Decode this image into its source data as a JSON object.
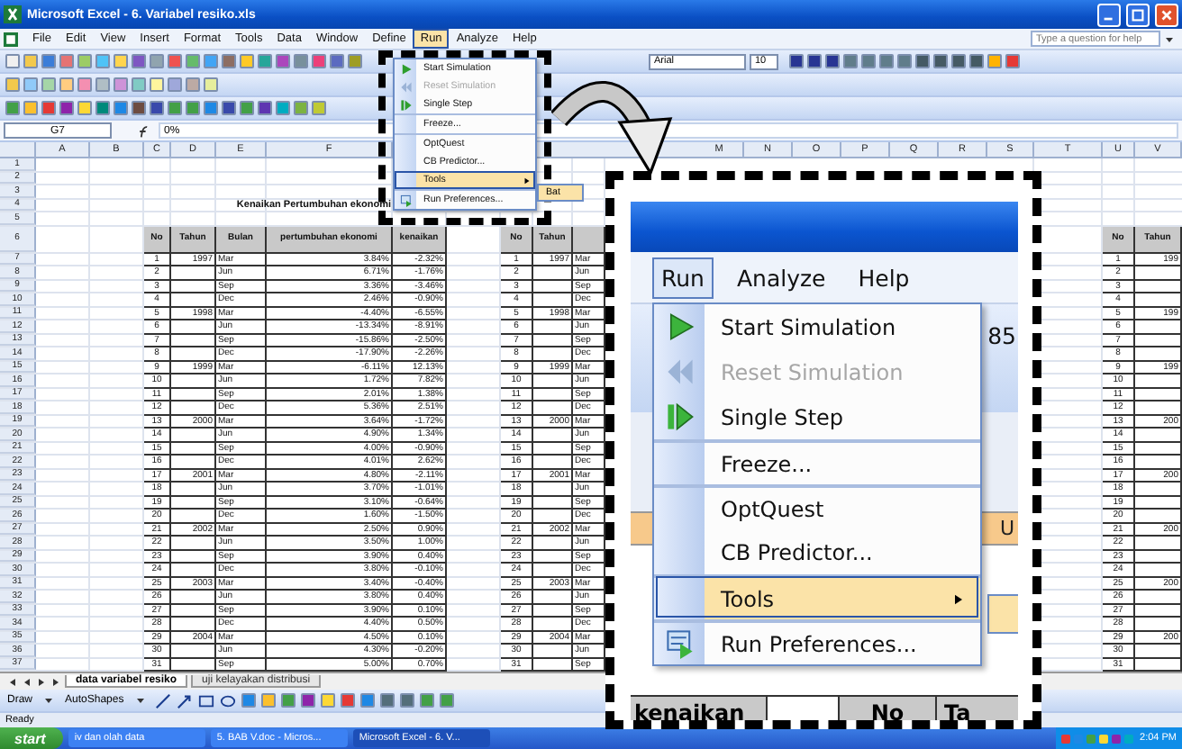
{
  "window": {
    "title": "Microsoft Excel - 6. Variabel resiko.xls"
  },
  "menu_bar": [
    {
      "label": "File",
      "selected": false
    },
    {
      "label": "Edit",
      "selected": false
    },
    {
      "label": "View",
      "selected": false
    },
    {
      "label": "Insert",
      "selected": false
    },
    {
      "label": "Format",
      "selected": false
    },
    {
      "label": "Tools",
      "selected": false
    },
    {
      "label": "Data",
      "selected": false
    },
    {
      "label": "Window",
      "selected": false
    },
    {
      "label": "Define",
      "selected": false
    },
    {
      "label": "Run",
      "selected": true
    },
    {
      "label": "Analyze",
      "selected": false
    },
    {
      "label": "Help",
      "selected": false
    }
  ],
  "help_box": {
    "placeholder": "Type a question for help"
  },
  "font_box": {
    "value": "Arial"
  },
  "size_box": {
    "value": "10"
  },
  "formula_bar": {
    "name_box": "G7",
    "value": "0%"
  },
  "column_headers": [
    "A",
    "B",
    "C",
    "D",
    "E",
    "F",
    "M",
    "N",
    "O",
    "P",
    "Q",
    "R",
    "S",
    "T",
    "U",
    "V"
  ],
  "sheet": {
    "row_numbers": [
      "1",
      "2",
      "3",
      "4",
      "5",
      "6",
      "7",
      "8",
      "9",
      "10",
      "11",
      "12",
      "13",
      "14",
      "15",
      "16",
      "17",
      "18",
      "19",
      "20",
      "21",
      "22",
      "23",
      "24",
      "25",
      "26",
      "27",
      "28",
      "29",
      "30",
      "31",
      "32",
      "33",
      "34",
      "35",
      "36",
      "37"
    ],
    "title": "Kenaikan Pertumbuhan ekonomi",
    "table": {
      "columns": [
        "No",
        "Tahun",
        "Bulan",
        "pertumbuhan ekonomi",
        "kenaikan"
      ],
      "rows": [
        {
          "no": "1",
          "tahun": "1997",
          "bulan": "Mar",
          "growth": "3.84%",
          "kenaikan": "-2.32%"
        },
        {
          "no": "2",
          "bulan": "Jun",
          "growth": "6.71%",
          "kenaikan": "-1.76%"
        },
        {
          "no": "3",
          "bulan": "Sep",
          "growth": "3.36%",
          "kenaikan": "-3.46%"
        },
        {
          "no": "4",
          "bulan": "Dec",
          "growth": "2.46%",
          "kenaikan": "-0.90%"
        },
        {
          "no": "5",
          "tahun": "1998",
          "bulan": "Mar",
          "growth": "-4.40%",
          "kenaikan": "-6.55%"
        },
        {
          "no": "6",
          "bulan": "Jun",
          "growth": "-13.34%",
          "kenaikan": "-8.91%"
        },
        {
          "no": "7",
          "bulan": "Sep",
          "growth": "-15.86%",
          "kenaikan": "-2.50%"
        },
        {
          "no": "8",
          "bulan": "Dec",
          "growth": "-17.90%",
          "kenaikan": "-2.26%"
        },
        {
          "no": "9",
          "tahun": "1999",
          "bulan": "Mar",
          "growth": "-6.11%",
          "kenaikan": "12.13%"
        },
        {
          "no": "10",
          "bulan": "Jun",
          "growth": "1.72%",
          "kenaikan": "7.82%"
        },
        {
          "no": "11",
          "bulan": "Sep",
          "growth": "2.01%",
          "kenaikan": "1.38%"
        },
        {
          "no": "12",
          "bulan": "Dec",
          "growth": "5.36%",
          "kenaikan": "2.51%"
        },
        {
          "no": "13",
          "tahun": "2000",
          "bulan": "Mar",
          "growth": "3.64%",
          "kenaikan": "-1.72%"
        },
        {
          "no": "14",
          "bulan": "Jun",
          "growth": "4.90%",
          "kenaikan": "1.34%"
        },
        {
          "no": "15",
          "bulan": "Sep",
          "growth": "4.00%",
          "kenaikan": "-0.90%"
        },
        {
          "no": "16",
          "bulan": "Dec",
          "growth": "4.01%",
          "kenaikan": "2.62%"
        },
        {
          "no": "17",
          "tahun": "2001",
          "bulan": "Mar",
          "growth": "4.80%",
          "kenaikan": "-2.11%"
        },
        {
          "no": "18",
          "bulan": "Jun",
          "growth": "3.70%",
          "kenaikan": "-1.01%"
        },
        {
          "no": "19",
          "bulan": "Sep",
          "growth": "3.10%",
          "kenaikan": "-0.64%"
        },
        {
          "no": "20",
          "bulan": "Dec",
          "growth": "1.60%",
          "kenaikan": "-1.50%"
        },
        {
          "no": "21",
          "tahun": "2002",
          "bulan": "Mar",
          "growth": "2.50%",
          "kenaikan": "0.90%"
        },
        {
          "no": "22",
          "bulan": "Jun",
          "growth": "3.50%",
          "kenaikan": "1.00%"
        },
        {
          "no": "23",
          "bulan": "Sep",
          "growth": "3.90%",
          "kenaikan": "0.40%"
        },
        {
          "no": "24",
          "bulan": "Dec",
          "growth": "3.80%",
          "kenaikan": "-0.10%"
        },
        {
          "no": "25",
          "tahun": "2003",
          "bulan": "Mar",
          "growth": "3.40%",
          "kenaikan": "-0.40%"
        },
        {
          "no": "26",
          "bulan": "Jun",
          "growth": "3.80%",
          "kenaikan": "0.40%"
        },
        {
          "no": "27",
          "bulan": "Sep",
          "growth": "3.90%",
          "kenaikan": "0.10%"
        },
        {
          "no": "28",
          "bulan": "Dec",
          "growth": "4.40%",
          "kenaikan": "0.50%"
        },
        {
          "no": "29",
          "tahun": "2004",
          "bulan": "Mar",
          "growth": "4.50%",
          "kenaikan": "0.10%"
        },
        {
          "no": "30",
          "bulan": "Jun",
          "growth": "4.30%",
          "kenaikan": "-0.20%"
        },
        {
          "no": "31",
          "bulan": "Sep",
          "growth": "5.00%",
          "kenaikan": "0.70%"
        }
      ]
    },
    "table_2": {
      "columns": [
        "No",
        "Tahun"
      ],
      "rows": [
        {
          "no": "1",
          "tahun": "1997",
          "bulan": "Mar"
        },
        {
          "no": "2",
          "bulan": "Jun"
        },
        {
          "no": "3",
          "bulan": "Sep"
        },
        {
          "no": "4",
          "bulan": "Dec"
        },
        {
          "no": "5",
          "tahun": "1998",
          "bulan": "Mar"
        },
        {
          "no": "6",
          "bulan": "Jun"
        },
        {
          "no": "7",
          "bulan": "Sep"
        },
        {
          "no": "8",
          "bulan": "Dec"
        },
        {
          "no": "9",
          "tahun": "1999",
          "bulan": "Mar"
        },
        {
          "no": "10",
          "bulan": "Jun"
        },
        {
          "no": "11",
          "bulan": "Sep"
        },
        {
          "no": "12",
          "bulan": "Dec"
        },
        {
          "no": "13",
          "tahun": "2000",
          "bulan": "Mar"
        },
        {
          "no": "14",
          "bulan": "Jun"
        },
        {
          "no": "15",
          "bulan": "Sep"
        },
        {
          "no": "16",
          "bulan": "Dec"
        },
        {
          "no": "17",
          "tahun": "2001",
          "bulan": "Mar"
        },
        {
          "no": "18",
          "bulan": "Jun"
        },
        {
          "no": "19",
          "bulan": "Sep"
        },
        {
          "no": "20",
          "bulan": "Dec"
        },
        {
          "no": "21",
          "tahun": "2002",
          "bulan": "Mar"
        },
        {
          "no": "22",
          "bulan": "Jun"
        },
        {
          "no": "23",
          "bulan": "Sep"
        },
        {
          "no": "24",
          "bulan": "Dec"
        },
        {
          "no": "25",
          "tahun": "2003",
          "bulan": "Mar"
        },
        {
          "no": "26",
          "bulan": "Jun"
        },
        {
          "no": "27",
          "bulan": "Sep"
        },
        {
          "no": "28",
          "bulan": "Dec"
        },
        {
          "no": "29",
          "tahun": "2004",
          "bulan": "Mar"
        },
        {
          "no": "30",
          "bulan": "Jun"
        },
        {
          "no": "31",
          "bulan": "Sep"
        }
      ]
    },
    "table_3": {
      "columns": [
        "No",
        "Tahun"
      ],
      "rows": [
        {
          "no": "1",
          "tahun": "199"
        },
        {
          "no": "2"
        },
        {
          "no": "3"
        },
        {
          "no": "4"
        },
        {
          "no": "5",
          "tahun": "199"
        },
        {
          "no": "6"
        },
        {
          "no": "7"
        },
        {
          "no": "8"
        },
        {
          "no": "9",
          "tahun": "199"
        },
        {
          "no": "10"
        },
        {
          "no": "11"
        },
        {
          "no": "12"
        },
        {
          "no": "13",
          "tahun": "200"
        },
        {
          "no": "14"
        },
        {
          "no": "15"
        },
        {
          "no": "16"
        },
        {
          "no": "17",
          "tahun": "200"
        },
        {
          "no": "18"
        },
        {
          "no": "19"
        },
        {
          "no": "20"
        },
        {
          "no": "21",
          "tahun": "200"
        },
        {
          "no": "22"
        },
        {
          "no": "23"
        },
        {
          "no": "24"
        },
        {
          "no": "25",
          "tahun": "200"
        },
        {
          "no": "26"
        },
        {
          "no": "27"
        },
        {
          "no": "28"
        },
        {
          "no": "29",
          "tahun": "200"
        },
        {
          "no": "30"
        },
        {
          "no": "31"
        }
      ]
    }
  },
  "run_menu": {
    "items": [
      {
        "label": "Start Simulation",
        "disabled": false,
        "selected": false,
        "separated": false,
        "submenu": false
      },
      {
        "label": "Reset Simulation",
        "disabled": true,
        "selected": false,
        "separated": false,
        "submenu": false
      },
      {
        "label": "Single Step",
        "disabled": false,
        "selected": false,
        "separated": false,
        "submenu": false
      },
      {
        "label": "Freeze...",
        "disabled": false,
        "selected": false,
        "separated": true,
        "submenu": false
      },
      {
        "label": "OptQuest",
        "disabled": false,
        "selected": false,
        "separated": true,
        "submenu": false
      },
      {
        "label": "CB Predictor...",
        "disabled": false,
        "selected": false,
        "separated": false,
        "submenu": false
      },
      {
        "label": "Tools",
        "disabled": false,
        "selected": true,
        "separated": false,
        "submenu": true
      },
      {
        "label": "Run Preferences...",
        "disabled": false,
        "selected": false,
        "separated": true,
        "submenu": false
      }
    ],
    "submenu_item": "Bat"
  },
  "callout": {
    "menu_bar": [
      {
        "label": "Run",
        "selected": true
      },
      {
        "label": "Analyze",
        "selected": false
      },
      {
        "label": "Help",
        "selected": false
      }
    ],
    "zoom_value": "85",
    "column_letter": "U",
    "headers": [
      "kenaikan",
      "No",
      "Ta"
    ],
    "items": [
      {
        "label": "Start Simulation",
        "disabled": false,
        "selected": false,
        "separated": false,
        "submenu": false
      },
      {
        "label": "Reset Simulation",
        "disabled": true,
        "selected": false,
        "separated": false,
        "submenu": false
      },
      {
        "label": "Single Step",
        "disabled": false,
        "selected": false,
        "separated": false,
        "submenu": false
      },
      {
        "label": "Freeze...",
        "disabled": false,
        "selected": false,
        "separated": true,
        "submenu": false
      },
      {
        "label": "OptQuest",
        "disabled": false,
        "selected": false,
        "separated": true,
        "submenu": false
      },
      {
        "label": "CB Predictor...",
        "disabled": false,
        "selected": false,
        "separated": false,
        "submenu": false
      },
      {
        "label": "Tools",
        "disabled": false,
        "selected": true,
        "separated": true,
        "submenu": true
      },
      {
        "label": "Run Preferences...",
        "disabled": false,
        "selected": false,
        "separated": true,
        "submenu": false
      }
    ]
  },
  "sheet_tabs": [
    {
      "label": "data variabel resiko",
      "selected": true
    },
    {
      "label": "uji kelayakan distribusi",
      "selected": false
    }
  ],
  "drawing_toolbar": {
    "draw": "Draw",
    "autoshapes": "AutoShapes"
  },
  "status_bar": "Ready",
  "taskbar": {
    "start": "start",
    "tasks": [
      {
        "label": "iv dan olah data",
        "selected": false
      },
      {
        "label": "5. BAB V.doc - Micros...",
        "selected": false
      },
      {
        "label": "Microsoft Excel - 6. V...",
        "selected": true
      }
    ],
    "time": "2:04 PM"
  }
}
